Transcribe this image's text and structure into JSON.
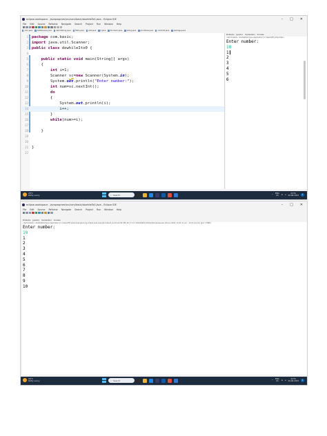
{
  "window": {
    "title_top": "eclipse-workspace - javaprogram/src/com/basic/dowhileTo0.java - Eclipse IDE",
    "title_bottom": "eclipse-workspace - javaprogram/src/com/basic/dowhileTo0.java - Eclipse IDE",
    "controls": [
      "–",
      "□",
      "✕"
    ]
  },
  "menu": [
    "File",
    "Edit",
    "Source",
    "Refactor",
    "Navigate",
    "Search",
    "Project",
    "Run",
    "Window",
    "Help"
  ],
  "editor_tabs": [
    "sum.java",
    "dataSquare.java",
    "demoString.java",
    "Hello.java",
    "add.java",
    "ll.java",
    "forcheck.java",
    "string.java",
    "printmiss.java",
    "controlit.java",
    "package.java"
  ],
  "view_tabs": [
    "Problems",
    "Javadoc",
    "Declaration",
    "Console"
  ],
  "code_lines": [
    {
      "n": "1",
      "tokens": [
        {
          "t": "package ",
          "c": "kw"
        },
        {
          "t": "com.basic;",
          "c": ""
        }
      ]
    },
    {
      "n": "2",
      "tokens": [
        {
          "t": "import ",
          "c": "kw"
        },
        {
          "t": "java.util.Scanner;",
          "c": ""
        }
      ]
    },
    {
      "n": "3",
      "tokens": [
        {
          "t": "public class ",
          "c": "kw"
        },
        {
          "t": "dowhileIto0 {",
          "c": ""
        }
      ]
    },
    {
      "n": "4",
      "tokens": []
    },
    {
      "n": "5",
      "tokens": [
        {
          "t": "    ",
          "c": ""
        },
        {
          "t": "public static void ",
          "c": "kw"
        },
        {
          "t": "main(String[] args)",
          "c": ""
        }
      ]
    },
    {
      "n": "6",
      "tokens": [
        {
          "t": "    {",
          "c": ""
        }
      ]
    },
    {
      "n": "7",
      "tokens": [
        {
          "t": "        ",
          "c": ""
        },
        {
          "t": "int ",
          "c": "kw"
        },
        {
          "t": "i=1;",
          "c": ""
        }
      ]
    },
    {
      "n": "8",
      "tokens": [
        {
          "t": "        Scanner ",
          "c": ""
        },
        {
          "t": "sc",
          "c": "warn"
        },
        {
          "t": "=",
          "c": ""
        },
        {
          "t": "new ",
          "c": "kw"
        },
        {
          "t": "Scanner(System.",
          "c": ""
        },
        {
          "t": "in",
          "c": "fld"
        },
        {
          "t": ");",
          "c": ""
        }
      ]
    },
    {
      "n": "9",
      "tokens": [
        {
          "t": "        System.",
          "c": ""
        },
        {
          "t": "out",
          "c": "fld"
        },
        {
          "t": ".println(",
          "c": ""
        },
        {
          "t": "\"Enter number:\"",
          "c": "str"
        },
        {
          "t": ");",
          "c": ""
        }
      ]
    },
    {
      "n": "10",
      "tokens": [
        {
          "t": "        ",
          "c": ""
        },
        {
          "t": "int ",
          "c": "kw"
        },
        {
          "t": "num=sc.nextInt();",
          "c": ""
        }
      ]
    },
    {
      "n": "11",
      "tokens": [
        {
          "t": "        ",
          "c": ""
        },
        {
          "t": "do",
          "c": "kw"
        }
      ]
    },
    {
      "n": "12",
      "tokens": [
        {
          "t": "        {",
          "c": ""
        }
      ]
    },
    {
      "n": "13",
      "tokens": [
        {
          "t": "            System.",
          "c": ""
        },
        {
          "t": "out",
          "c": "fld"
        },
        {
          "t": ".println(i);",
          "c": ""
        }
      ]
    },
    {
      "n": "14",
      "tokens": [
        {
          "t": "            i++;",
          "c": ""
        }
      ]
    },
    {
      "n": "15",
      "tokens": [
        {
          "t": "        }",
          "c": ""
        }
      ]
    },
    {
      "n": "16",
      "tokens": [
        {
          "t": "        ",
          "c": ""
        },
        {
          "t": "while",
          "c": "kw"
        },
        {
          "t": "(num>=i);",
          "c": ""
        }
      ]
    },
    {
      "n": "17",
      "tokens": []
    },
    {
      "n": "18",
      "tokens": [
        {
          "t": "    }",
          "c": ""
        }
      ]
    },
    {
      "n": "19",
      "tokens": []
    },
    {
      "n": "20",
      "tokens": []
    },
    {
      "n": "21",
      "tokens": [
        {
          "t": "}",
          "c": ""
        }
      ]
    },
    {
      "n": "22",
      "tokens": []
    }
  ],
  "console_top": {
    "terminated": "<terminated> dowhileIto0 [Java Application] C:\\Users\\HP\\.p2\\pool\\plu",
    "prompt": "Enter number:",
    "input": "10",
    "output": [
      "1",
      "2",
      "3",
      "4",
      "5",
      "6"
    ]
  },
  "console_bottom": {
    "terminated": "<terminated> dowhileIto0 [Java Application] C:\\Users\\HP\\.p2\\pool\\plugins\\org.eclipse.justj.openjdk.hotspot.jre.full.win32.x86_64_17.0.7.v20230425-1502\\jre\\bin\\javaw.exe (29-Jun-2023, 10:31:11 pm – 10:31:14 pm) [pid: 17896]",
    "prompt": "Enter number:",
    "input": "10",
    "output": [
      "1",
      "2",
      "3",
      "4",
      "5",
      "6",
      "7",
      "8",
      "9",
      "10"
    ]
  },
  "taskbar": {
    "temperature": "29°C",
    "condition": "Partly sunny",
    "search": "Search",
    "lang": [
      "ENG",
      "US"
    ],
    "time": "22:51",
    "date": "29-06-2023",
    "notifications": "1"
  },
  "colors": {
    "keyword": "#7f0055",
    "string": "#2a00ff",
    "field": "#0000c0",
    "console_input": "#00c87d",
    "taskbar": "#1c2b3d"
  }
}
